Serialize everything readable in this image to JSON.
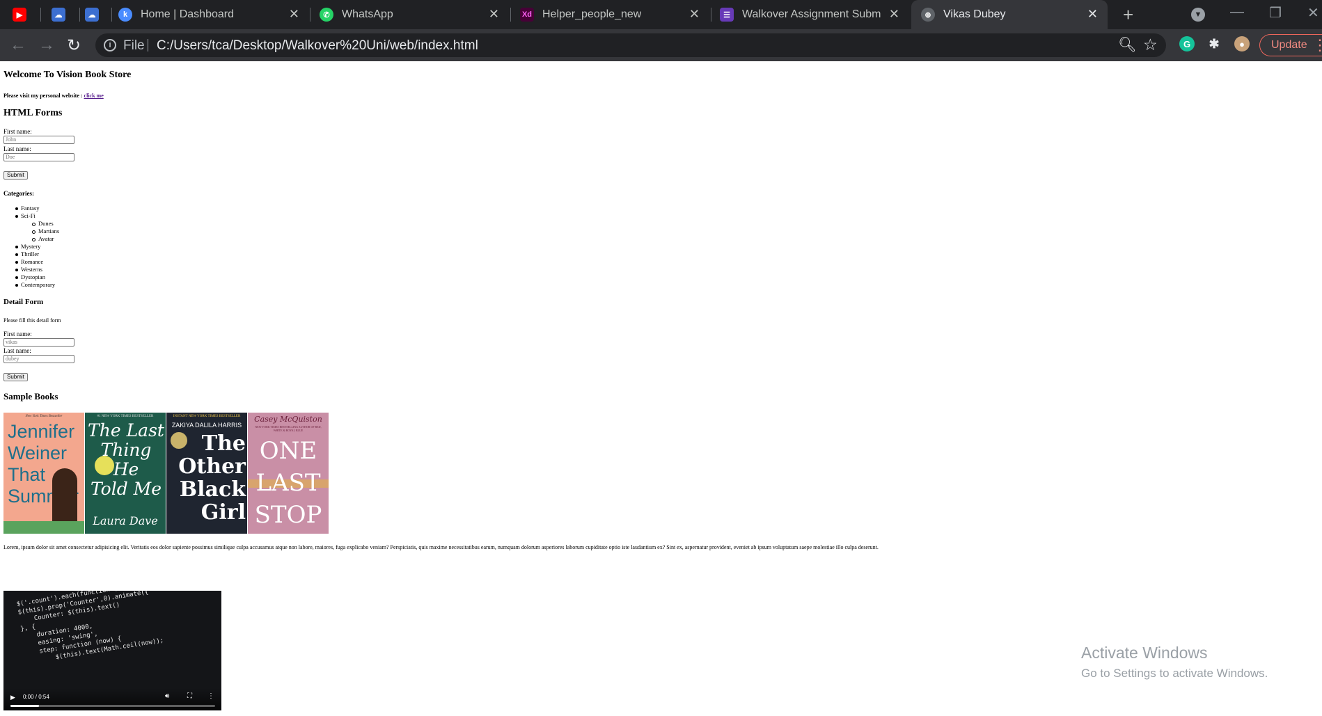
{
  "browser": {
    "tabs": [
      {
        "title": "",
        "icon": "youtube-icon",
        "color": "#ff0000"
      },
      {
        "title": "",
        "icon": "cloud-app-icon",
        "color": "#3c6fd1"
      },
      {
        "title": "",
        "icon": "cloud-app-icon",
        "color": "#3c6fd1"
      },
      {
        "title": "Home | Dashboard",
        "icon": "k-logo-icon",
        "color": "#4a8cff"
      },
      {
        "title": "WhatsApp",
        "icon": "whatsapp-icon",
        "color": "#25d366"
      },
      {
        "title": "Helper_people_new",
        "icon": "adobe-xd-icon",
        "color": "#470137"
      },
      {
        "title": "Walkover Assignment Submissi",
        "icon": "forms-icon",
        "color": "#673ab7"
      },
      {
        "title": "Vikas Dubey",
        "icon": "globe-icon",
        "color": "#5f6368"
      }
    ],
    "address": {
      "scheme": "File",
      "url": "C:/Users/tca/Desktop/Walkover%20Uni/web/index.html"
    },
    "update_label": "Update",
    "extensions": [
      {
        "icon": "grammarly-icon",
        "color": "#15c39a"
      },
      {
        "icon": "puzzle-extensions-icon",
        "color": "#e8eaed"
      },
      {
        "icon": "profile-avatar-icon",
        "color": "#c8a27a"
      }
    ]
  },
  "page": {
    "welcome": "Welcome To Vision Book Store",
    "visit_text": "Please visit my personal website : ",
    "visit_link": "click me",
    "forms_heading": "HTML Forms",
    "form1": {
      "first_label": "First name:",
      "first_value": "John",
      "last_label": "Last name:",
      "last_value": "Doe",
      "submit": "Submit"
    },
    "categories_title": "Categories:",
    "categories": [
      {
        "label": "Fantasy",
        "level": 0
      },
      {
        "label": "Sci-Fi",
        "level": 0
      },
      {
        "label": "Dunes",
        "level": 1
      },
      {
        "label": "Martians",
        "level": 1
      },
      {
        "label": "Avatar",
        "level": 1
      },
      {
        "label": "Mystery",
        "level": 0
      },
      {
        "label": "Thriller",
        "level": 0
      },
      {
        "label": "Romance",
        "level": 0
      },
      {
        "label": "Westerns",
        "level": 0
      },
      {
        "label": "Dystopian",
        "level": 0
      },
      {
        "label": "Contemporary",
        "level": 0
      }
    ],
    "detail_heading": "Detail Form",
    "detail_desc": "Please fill this detail form",
    "form2": {
      "first_label": "First name:",
      "first_placeholder": "vikas",
      "last_label": "Last name:",
      "last_placeholder": "dubey",
      "submit": "Submit"
    },
    "samples_heading": "Sample Books",
    "books": [
      {
        "tagline": "New York Times Bestseller",
        "lines": [
          "Jennifer",
          "Weiner",
          "That",
          "Summer"
        ],
        "bg": "#f3a78e",
        "fg": "#1f6f8b"
      },
      {
        "tagline": "#1 NEW YORK TIMES BESTSELLER",
        "lines": [
          "The Last",
          "Thing",
          "He",
          "Told Me",
          "Laura Dave"
        ],
        "bg": "#1e5b4a",
        "fg": "#ffffff"
      },
      {
        "tagline": "INSTANT NEW YORK TIMES BESTSELLER",
        "author": "ZAKIYA DALILA HARRIS",
        "lines": [
          "The",
          "Other",
          "Black",
          "Girl"
        ],
        "bg": "#1f2530",
        "fg": "#ffffff"
      },
      {
        "tagline": "NEW YORK TIMES BESTSELLING AUTHOR OF RED, WHITE & ROYAL BLUE",
        "author": "Casey McQuiston",
        "lines": [
          "ONE",
          "LAST",
          "STOP"
        ],
        "bg": "#c98fa6",
        "fg": "#ffffff"
      }
    ],
    "lorem": "Lorem, ipsum dolor sit amet consectetur adipisicing elit. Veritatis eos dolor sapiente possimus similique culpa accusamus atque non labore, maiores, fuga explicabo veniam? Perspiciatis, quis maxime necessitatibus earum, numquam dolorum asperiores laborum cupiditate optio iste laudantium ex? Sint ex, aspernatur provident, eveniet ab ipsum voluptatum saepe molestiae illo culpa deserunt.",
    "video": {
      "time": "0:00 / 0:54",
      "progress": 0.14,
      "code": "$('.count').each(function () {\n$(this).prop('Counter',0).animate({\n    Counter: $(this).text()\n}, {\n    duration: 4000,\n    easing: 'swing',\n    step: function (now) {\n        $(this).text(Math.ceil(now));"
    }
  },
  "watermark": {
    "line1": "Activate Windows",
    "line2": "Go to Settings to activate Windows."
  }
}
